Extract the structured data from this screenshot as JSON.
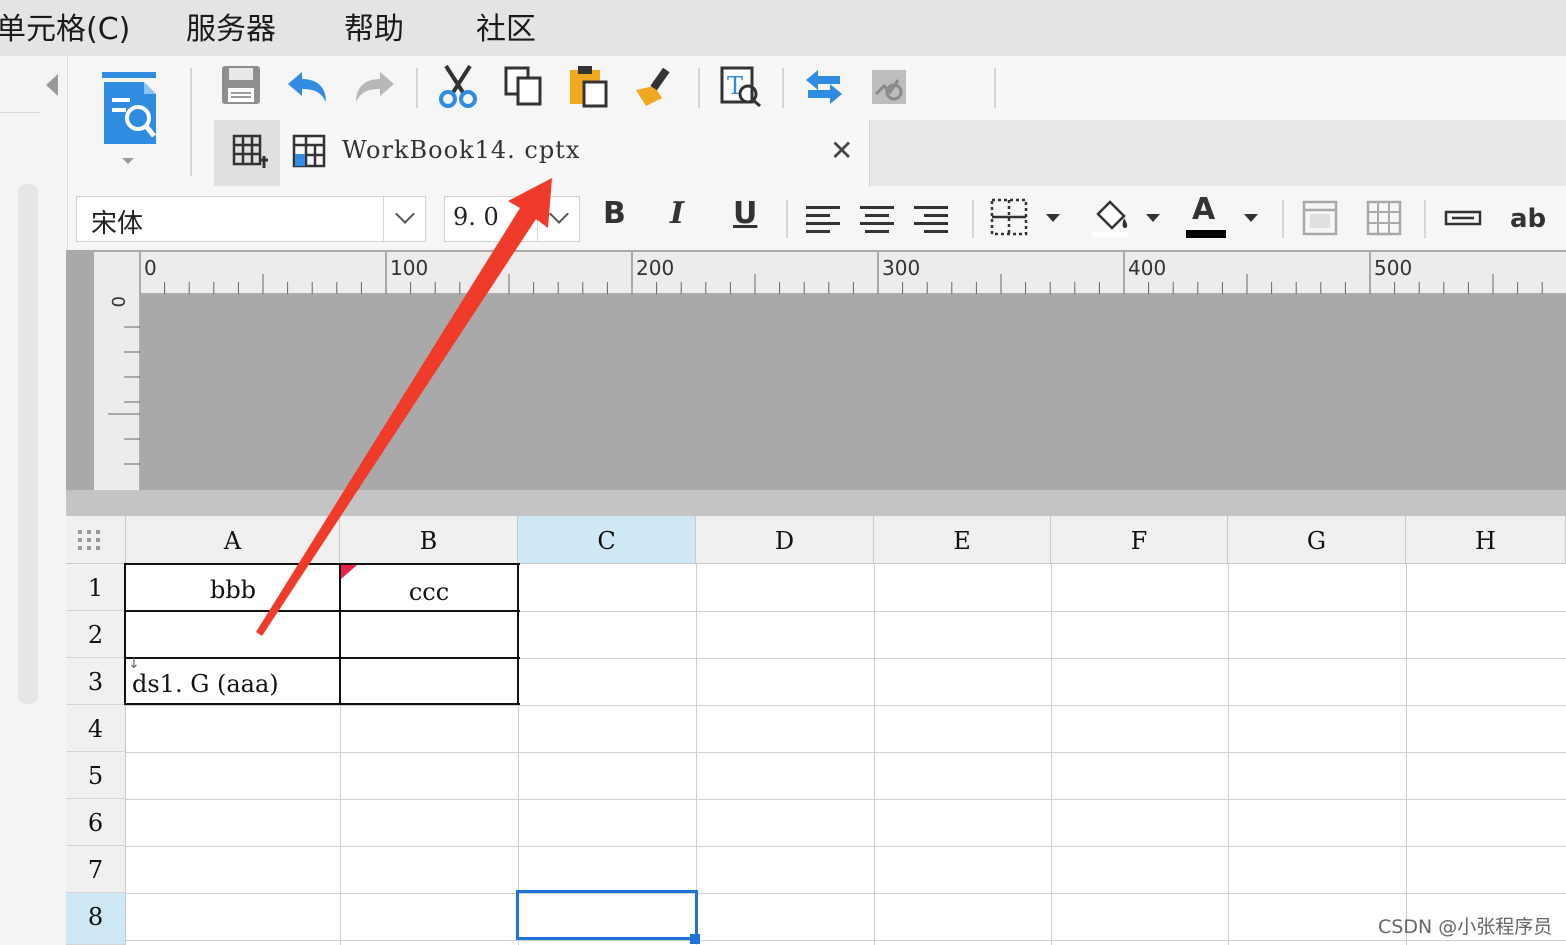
{
  "menu": {
    "items": [
      "单元格(C)",
      "服务器",
      "帮助",
      "社区"
    ]
  },
  "toolbar": {
    "icons": [
      "template-preview-icon",
      "save-icon",
      "undo-icon",
      "redo-icon",
      "cut-icon",
      "copy-icon",
      "paste-icon",
      "format-painter-icon",
      "text-search-icon",
      "swap-icon",
      "chart-search-icon"
    ]
  },
  "tabs": {
    "active_title": "WorkBook14. cptx",
    "close_glyph": "✕"
  },
  "format": {
    "font_name": "宋体",
    "font_size": "9. 0",
    "bold_label": "B",
    "italic_label": "I",
    "underline_label": "U",
    "fontcolor_label": "A",
    "wordwrap_label": "ab",
    "font_color": "#000000"
  },
  "ruler": {
    "h_labels": [
      "0",
      "100",
      "200",
      "300",
      "400",
      "500"
    ],
    "v_label": "0"
  },
  "sheet": {
    "columns": [
      "A",
      "B",
      "C",
      "D",
      "E",
      "F",
      "G",
      "H"
    ],
    "rows": [
      "1",
      "2",
      "3",
      "4",
      "5",
      "6",
      "7",
      "8"
    ],
    "selected_column": "C",
    "selected_row": "8",
    "cells": {
      "A1": "bbb",
      "B1": "ccc",
      "A3": "ds1. G (aaa)"
    }
  },
  "colors": {
    "selection": "#1e73d8",
    "annotation_arrow": "#f03a2a",
    "header_selected": "#cfe8f6"
  },
  "watermark": "CSDN @小张程序员"
}
